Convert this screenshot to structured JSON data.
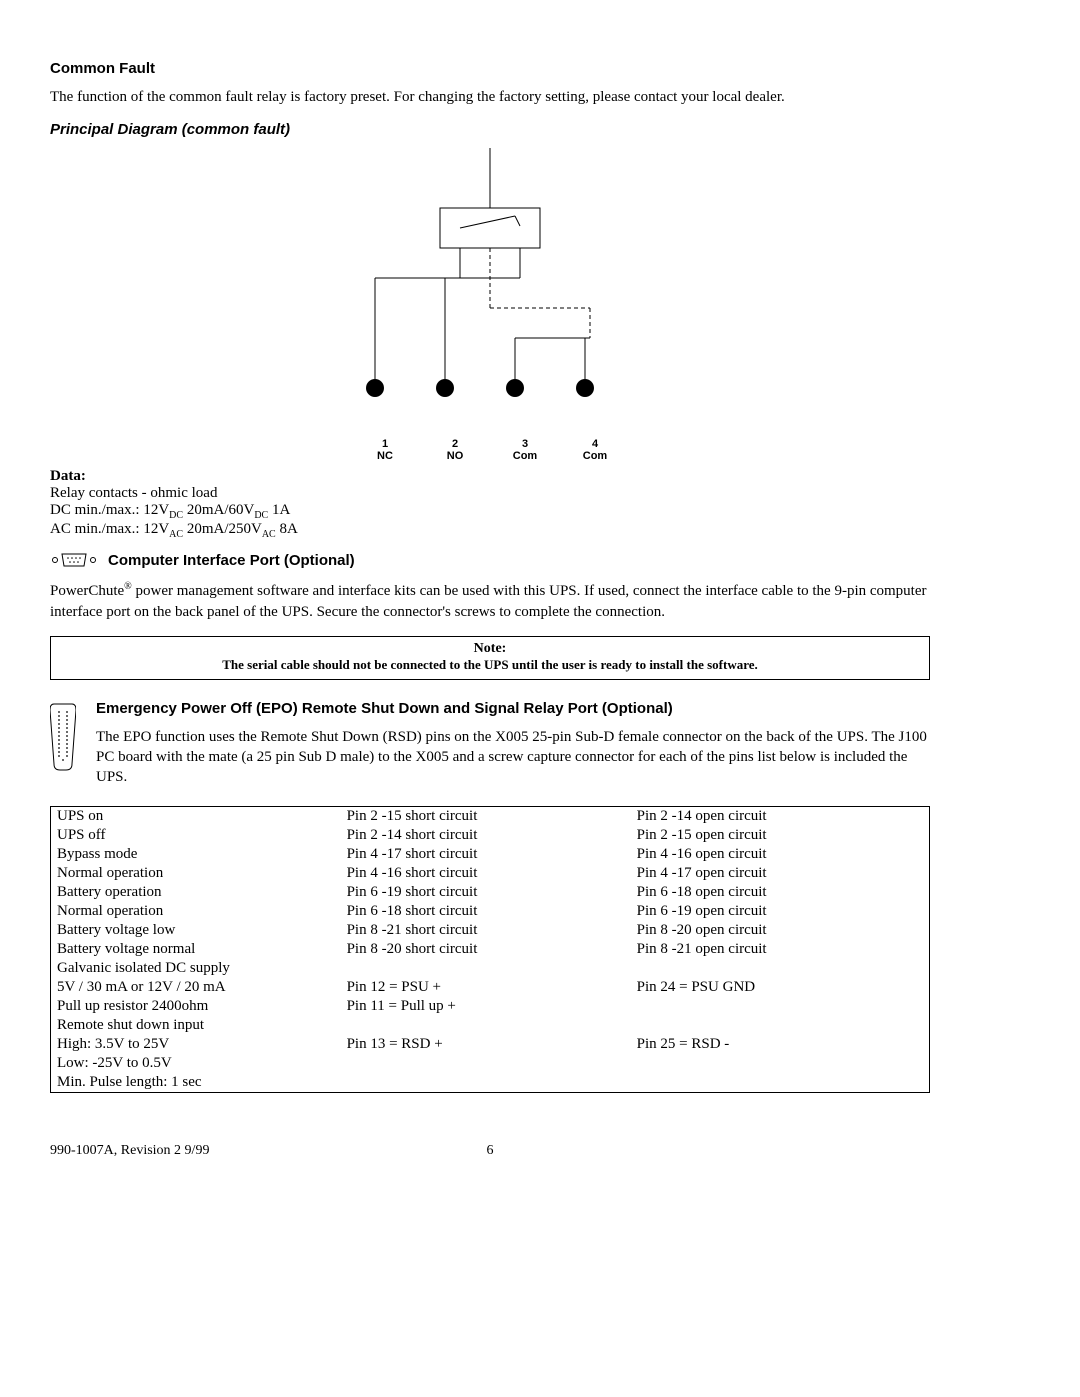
{
  "headings": {
    "common_fault": "Common Fault",
    "principal_diagram": "Principal Diagram (common fault)",
    "computer_interface": "Computer Interface Port (Optional)",
    "epo": "Emergency Power Off (EPO) Remote Shut Down and Signal Relay Port (Optional)"
  },
  "paragraphs": {
    "common_fault_body": "The function of the common fault relay is factory preset. For changing the factory setting, please contact your local dealer.",
    "computer_interface_body_1": "PowerChute",
    "computer_interface_body_2": " power management software and interface kits can be used with this UPS. If used, connect the interface cable to the 9-pin computer interface port on the back panel of the UPS. Secure the connector's screws to complete the connection.",
    "epo_body": "The EPO function uses the Remote Shut Down (RSD) pins on the X005 25-pin Sub-D female connector on the back of the UPS. The J100 PC board with the mate (a 25 pin Sub D male) to the X005 and a screw capture connector for each of the pins list below is included the UPS."
  },
  "data_section": {
    "title": "Data:",
    "line1": "Relay contacts - ohmic load",
    "line2_prefix": "DC min./max.: 12V",
    "line2_sub1": "DC",
    "line2_mid": " 20mA/60V",
    "line2_sub2": "DC",
    "line2_suffix": " 1A",
    "line3_prefix": "AC min./max.: 12V",
    "line3_sub1": "AC",
    "line3_mid": " 20mA/250V",
    "line3_sub2": "AC",
    "line3_suffix": " 8A"
  },
  "diagram_labels": [
    {
      "num": "1",
      "txt": "NC"
    },
    {
      "num": "2",
      "txt": "NO"
    },
    {
      "num": "3",
      "txt": "Com"
    },
    {
      "num": "4",
      "txt": "Com"
    }
  ],
  "note": {
    "title": "Note:",
    "body": "The serial cable should not be connected to the UPS until the user is ready to install the software."
  },
  "pin_table": [
    [
      [
        "UPS on",
        "Pin 2 -15 short circuit",
        "Pin 2 -14 open circuit"
      ],
      [
        "UPS off",
        "Pin 2 -14 short circuit",
        "Pin 2 -15 open circuit"
      ]
    ],
    [
      [
        "Bypass mode",
        "Pin 4 -17 short circuit",
        "Pin 4 -16 open circuit"
      ],
      [
        "Normal operation",
        "Pin 4 -16 short circuit",
        "Pin 4 -17 open circuit"
      ]
    ],
    [
      [
        "Battery operation",
        "Pin 6 -19 short circuit",
        "Pin 6 -18 open circuit"
      ],
      [
        "Normal operation",
        "Pin 6 -18 short circuit",
        "Pin 6 -19 open circuit"
      ]
    ],
    [
      [
        "Battery voltage low",
        "Pin 8 -21 short circuit",
        "Pin 8 -20 open circuit"
      ],
      [
        "Battery voltage normal",
        "Pin 8 -20 short circuit",
        "Pin 8 -21 open circuit"
      ]
    ],
    [
      [
        "Galvanic isolated DC supply",
        "",
        ""
      ],
      [
        "5V / 30 mA or 12V / 20 mA",
        "Pin 12 = PSU +",
        "Pin 24 = PSU GND"
      ],
      [
        "Pull up resistor 2400ohm",
        "Pin 11 = Pull up +",
        ""
      ]
    ],
    [
      [
        "Remote shut down input",
        "",
        ""
      ],
      [
        "High: 3.5V to 25V",
        "Pin 13 = RSD +",
        "Pin 25 = RSD -"
      ],
      [
        "Low: -25V to 0.5V",
        "",
        ""
      ],
      [
        "Min. Pulse length: 1 sec",
        "",
        ""
      ]
    ]
  ],
  "footer": {
    "left": "990-1007A, Revision 2  9/99",
    "page": "6"
  },
  "chart_data": {
    "type": "diagram",
    "description": "Principal diagram of common fault relay showing a schematic with a normally-closed / normally-open relay switch feeding four output terminals labelled 1 NC, 2 NO, 3 Com, 4 Com.",
    "terminals": [
      {
        "id": 1,
        "label": "NC"
      },
      {
        "id": 2,
        "label": "NO"
      },
      {
        "id": 3,
        "label": "Com"
      },
      {
        "id": 4,
        "label": "Com"
      }
    ]
  }
}
